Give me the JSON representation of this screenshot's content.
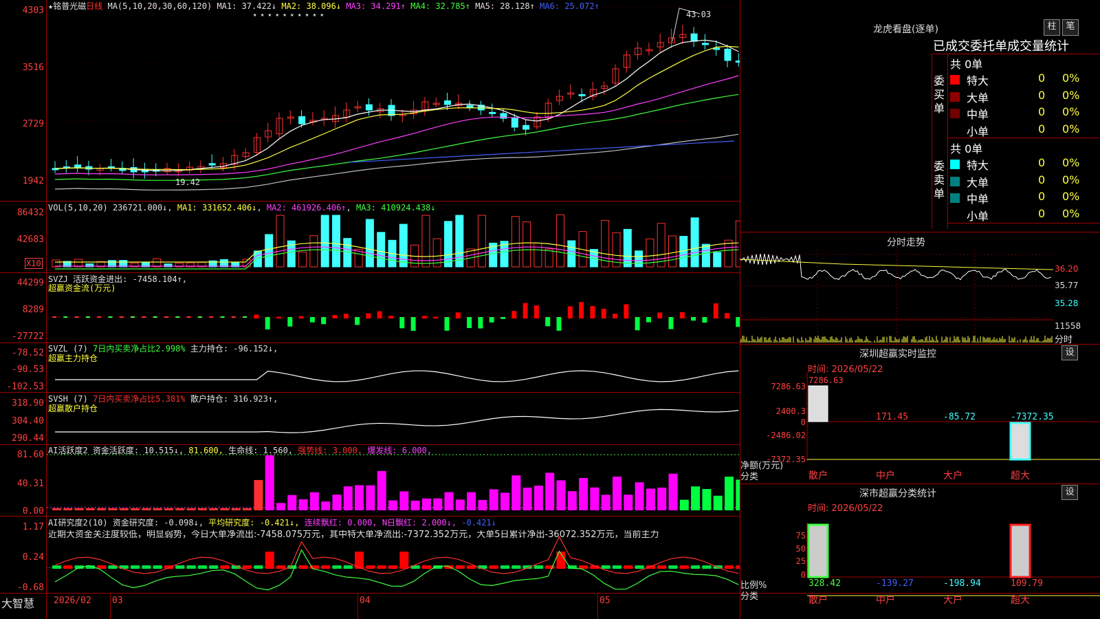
{
  "header": {
    "stock": "★铭普光磁",
    "period": "日线",
    "ma_params": "MA(5,10,20,30,60,120)",
    "ma1": "MA1: 37.422↓",
    "ma2": "MA2: 38.096↓",
    "ma3": "MA3: 34.291↑",
    "ma4": "MA4: 32.785↑",
    "ma5": "MA5: 28.128↑",
    "ma6": "MA6: 25.072↑",
    "high": "43.03",
    "low": "19.42",
    "stars": "★ ★ ★ ★   ★ ★ ★ ★   ★       ★"
  },
  "price_axis": [
    "4303",
    "3516",
    "2729",
    "1942"
  ],
  "vol": {
    "label": "VOL(5,10,20)",
    "val": "236721.000↓",
    "ma1": "MA1: 331652.406↓",
    "ma2": "MA2: 461926.406↑",
    "ma3": "MA3: 410924.438↓",
    "axis": [
      "86432",
      "42683"
    ],
    "unit": "X10"
  },
  "svzj": {
    "label": "SVZJ",
    "title": "活跃资金进出: -7458.104↑,",
    "sub": "超赢资金流(万元)",
    "axis": [
      "44299",
      "8289",
      "-27722"
    ]
  },
  "svzl": {
    "label": "SVZL (7)",
    "ratio": "7日内买卖净占比2.998%",
    "hold": "主力持仓: -96.152↓,",
    "sub": "超赢主力持仓",
    "axis": [
      "-78.52",
      "-90.53",
      "-102.53"
    ]
  },
  "svsh": {
    "label": "SVSH (7)",
    "ratio": "7日内买卖净占比5.381%",
    "hold": "散户持仓: 316.923↑,",
    "sub": "超赢散户持仓",
    "axis": [
      "318.90",
      "304.40",
      "290.44"
    ]
  },
  "ai1": {
    "label": "AI活跃度2",
    "act": "资金活跃度: 10.515↓,",
    "v2": "81.600,",
    "life": "生命线: 1.560,",
    "strong": "强势线: 3.000,",
    "burst": "爆发线: 6.000,",
    "axis": [
      "81.60",
      "40.31",
      "0.00"
    ]
  },
  "ai2": {
    "label": "AI研究度2(10)",
    "res": "资金研究度: -0.098↓,",
    "avg": "平均研究度: -0.421↓,",
    "red": "连续飘红: 0.000,",
    "nred": "N日飘红: 2.000↓,",
    "last": "-0.421↓",
    "axis": [
      "1.17",
      "0.24",
      "-0.68"
    ],
    "note": "近期大资金关注度较低，明显弱势，今日大单净流出:-7458.075万元，其中特大单净流出:-7372.352万元，大单5日累计净出-36072.352万元，当前主力"
  },
  "footer": {
    "brand": "大智慧",
    "dates": [
      "2026/02",
      "03",
      "04",
      "05"
    ]
  },
  "right": {
    "title": "龙虎看盘(逐单)",
    "btn1": "柱",
    "btn2": "笔",
    "tabs": "已成交委托单成交量统计",
    "buy_label": "委买单",
    "sell_label": "委卖单",
    "buy_count": "共 0单",
    "sell_count": "共 0单",
    "buy_rows": [
      {
        "name": "特大",
        "v": "0",
        "p": "0%",
        "color": "#ff0000"
      },
      {
        "name": "大单",
        "v": "0",
        "p": "0%",
        "color": "#900000"
      },
      {
        "name": "中单",
        "v": "0",
        "p": "0%",
        "color": "#700000"
      },
      {
        "name": "小单",
        "v": "0",
        "p": "0%",
        "color": "#000"
      }
    ],
    "sell_rows": [
      {
        "name": "特大",
        "v": "0",
        "p": "0%",
        "color": "#00ffff"
      },
      {
        "name": "大单",
        "v": "0",
        "p": "0%",
        "color": "#008080"
      },
      {
        "name": "中单",
        "v": "0",
        "p": "0%",
        "color": "#008080"
      },
      {
        "name": "小单",
        "v": "0",
        "p": "0%",
        "color": "#000"
      }
    ],
    "fs_title": "分时走势",
    "fs_axis": [
      "36.20",
      "35.77",
      "35.28",
      "11558"
    ],
    "fs_unit": "分时",
    "sz_title": "深圳超赢实时监控",
    "set": "设",
    "time": "时间: 2026/05/22",
    "sz_axis": [
      "7286.63",
      "2400.3",
      "0",
      "-2486.02",
      "-7372.35"
    ],
    "sz_top": "7286.63",
    "sz_vals": [
      "171.45",
      "-85.72",
      "-7372.35"
    ],
    "net_label": "净额(万元)",
    "cat_label": "分类",
    "cats": [
      "散户",
      "中户",
      "大户",
      "超大"
    ],
    "cl_title": "深市超赢分类统计",
    "cl_time": "时间: 2026/05/22",
    "cl_axis": [
      "75",
      "50",
      "25",
      "0"
    ],
    "cl_vals": [
      "328.42",
      "-139.27",
      "-198.94",
      "109.79"
    ],
    "ratio_label": "比例%"
  }
}
